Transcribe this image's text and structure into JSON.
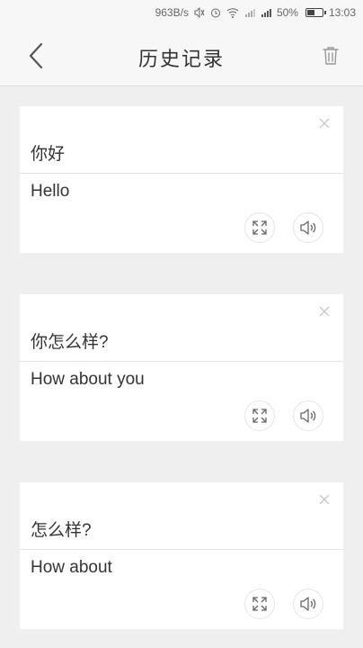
{
  "status_bar": {
    "speed": "963B/s",
    "battery": "50%",
    "time": "13:03"
  },
  "app_bar": {
    "title": "历史记录"
  },
  "history": [
    {
      "source": "你好",
      "translation": "Hello"
    },
    {
      "source": "你怎么样?",
      "translation": "How about you"
    },
    {
      "source": "怎么样?",
      "translation": "How about"
    }
  ],
  "icons": {
    "back": "back-arrow-icon",
    "trash": "trash-icon",
    "close": "close-icon",
    "expand": "expand-icon",
    "speaker": "speaker-icon"
  }
}
